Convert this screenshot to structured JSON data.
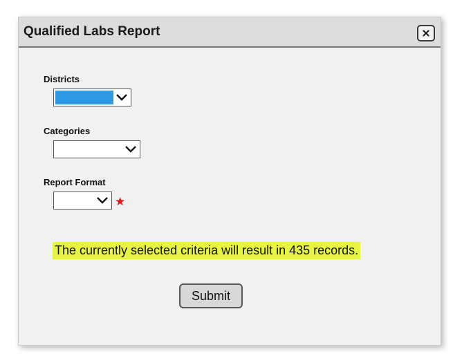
{
  "dialog": {
    "title": "Qualified Labs Report",
    "close_icon": "close-icon"
  },
  "form": {
    "districts": {
      "label": "Districts",
      "selected_value": "",
      "highlighted": true,
      "highlight_color": "#2e9ae6"
    },
    "categories": {
      "label": "Categories",
      "selected_value": ""
    },
    "report_format": {
      "label": "Report Format",
      "selected_value": "",
      "required": true,
      "required_marker": "★",
      "required_color": "#e01414"
    }
  },
  "status": {
    "message": "The currently selected criteria will result in 435 records.",
    "highlight_color": "#e7f542"
  },
  "actions": {
    "submit_label": "Submit"
  }
}
